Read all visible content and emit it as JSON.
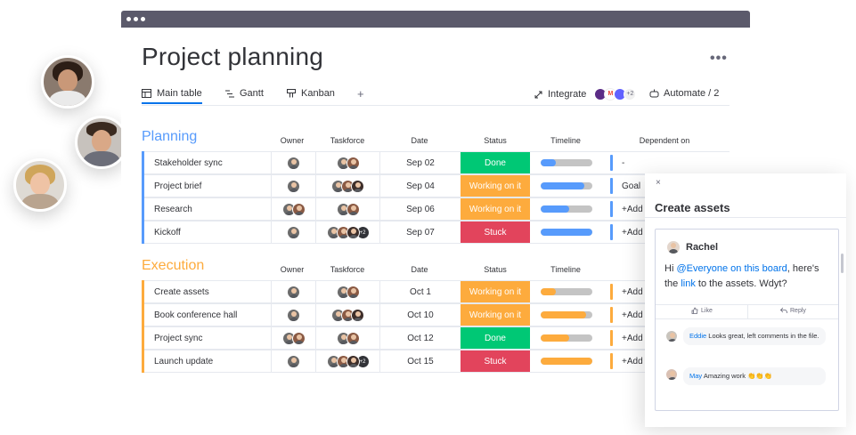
{
  "header": {
    "title": "Project planning",
    "more": "•••"
  },
  "tabs": [
    {
      "label": "Main table",
      "icon": "table-icon",
      "active": true
    },
    {
      "label": "Gantt",
      "icon": "gantt-icon",
      "active": false
    },
    {
      "label": "Kanban",
      "icon": "kanban-icon",
      "active": false
    }
  ],
  "add_tab": "+",
  "integrate": {
    "label": "Integrate",
    "badge": "+2"
  },
  "automate": {
    "label": "Automate / 2"
  },
  "columns": {
    "owner": "Owner",
    "taskforce": "Taskforce",
    "date": "Date",
    "status": "Status",
    "timeline": "Timeline",
    "dependent": "Dependent on"
  },
  "groups": [
    {
      "title": "Planning",
      "color": "#579bfc",
      "rows": [
        {
          "name": "Stakeholder sync",
          "date": "Sep 02",
          "status": "Done",
          "status_color": "#00c875",
          "timeline": 0.3,
          "timeline_color": "#579bfc",
          "dependent": "-",
          "plus": ""
        },
        {
          "name": "Project brief",
          "date": "Sep 04",
          "status": "Working on it",
          "status_color": "#fdab3d",
          "timeline": 0.85,
          "timeline_color": "#579bfc",
          "dependent": "Goal",
          "plus": ""
        },
        {
          "name": "Research",
          "date": "Sep 06",
          "status": "Working on it",
          "status_color": "#fdab3d",
          "timeline": 0.55,
          "timeline_color": "#579bfc",
          "dependent": "+Add",
          "plus": ""
        },
        {
          "name": "Kickoff",
          "date": "Sep 07",
          "status": "Stuck",
          "status_color": "#e2445c",
          "timeline": 1.0,
          "timeline_color": "#579bfc",
          "dependent": "+Add",
          "plus": "+2"
        }
      ]
    },
    {
      "title": "Execution",
      "color": "#fdab3d",
      "rows": [
        {
          "name": "Create assets",
          "date": "Oct 1",
          "status": "Working on it",
          "status_color": "#fdab3d",
          "timeline": 0.3,
          "timeline_color": "#fdab3d",
          "dependent": "+Add",
          "plus": ""
        },
        {
          "name": "Book conference hall",
          "date": "Oct 10",
          "status": "Working on it",
          "status_color": "#fdab3d",
          "timeline": 0.88,
          "timeline_color": "#fdab3d",
          "dependent": "+Add",
          "plus": ""
        },
        {
          "name": "Project sync",
          "date": "Oct 12",
          "status": "Done",
          "status_color": "#00c875",
          "timeline": 0.55,
          "timeline_color": "#fdab3d",
          "dependent": "+Add",
          "plus": ""
        },
        {
          "name": "Launch update",
          "date": "Oct 15",
          "status": "Stuck",
          "status_color": "#e2445c",
          "timeline": 1.0,
          "timeline_color": "#fdab3d",
          "dependent": "+Add",
          "plus": "+2"
        }
      ]
    }
  ],
  "panel": {
    "close": "×",
    "title": "Create assets",
    "author": "Rachel",
    "text_pre": "Hi ",
    "mention": "@Everyone on this board",
    "text_mid": ", here's the ",
    "link": "link",
    "text_post": " to the assets. Wdyt?",
    "like": "Like",
    "reply": "Reply",
    "replies": [
      {
        "who": "Eddie",
        "text": " Looks great, left comments in the file."
      },
      {
        "who": "May",
        "text": " Amazing work 👏👏👏"
      }
    ]
  }
}
